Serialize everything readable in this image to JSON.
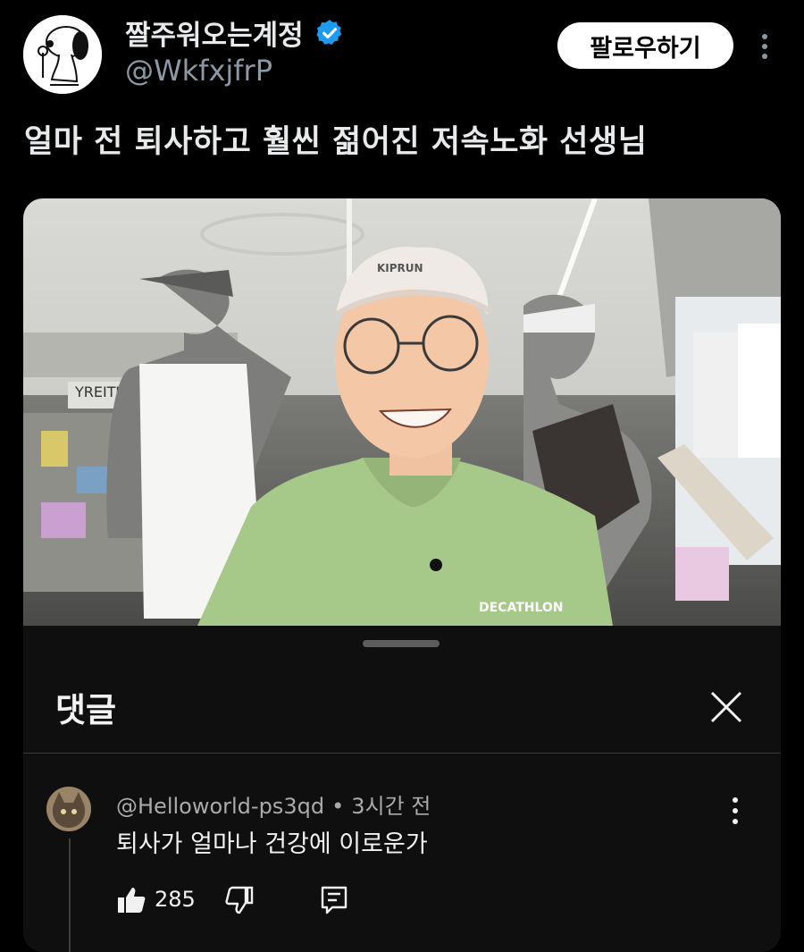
{
  "post": {
    "display_name": "짤주워오는계정",
    "handle": "@WkfxjfrP",
    "follow_label": "팔로우하기",
    "text": "얼마 전 퇴사하고 훨씬 젊어진 저속노화 선생님"
  },
  "video_overlay": {
    "cap_text": "KIPRUN",
    "shirt_text": "DECATHLON",
    "store_sign": "YREITUY"
  },
  "comments_panel": {
    "title": "댓글",
    "comment": {
      "author": "@Helloworld-ps3qd",
      "separator": "•",
      "time": "3시간 전",
      "text": "퇴사가 얼마나 건강에 이로운가",
      "likes": "285"
    }
  },
  "colors": {
    "verified": "#1d9bf0",
    "background": "#000000",
    "sheet": "#0f0f0f",
    "follow_button": "#ffffff"
  },
  "icons": [
    "snoopy-avatar-icon",
    "verified-badge-icon",
    "more-options-icon",
    "close-icon",
    "thumb-up-icon",
    "thumb-down-icon",
    "reply-icon"
  ]
}
